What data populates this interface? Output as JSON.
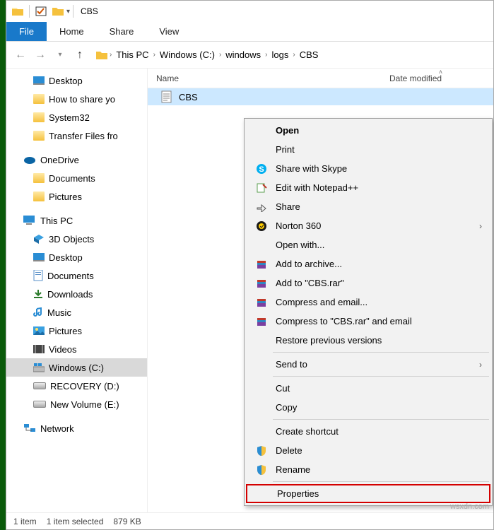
{
  "titlebar": {
    "title": "CBS"
  },
  "ribbon": {
    "file": "File",
    "home": "Home",
    "share": "Share",
    "view": "View"
  },
  "breadcrumb": [
    "This PC",
    "Windows (C:)",
    "windows",
    "logs",
    "CBS"
  ],
  "columns": {
    "name": "Name",
    "date": "Date modified"
  },
  "file": {
    "name": "CBS"
  },
  "tree": {
    "desktop": "Desktop",
    "howto": "How to share yo",
    "system32": "System32",
    "transfer": "Transfer Files fro",
    "onedrive": "OneDrive",
    "documents": "Documents",
    "pictures": "Pictures",
    "thispc": "This PC",
    "obj3d": "3D Objects",
    "desktop2": "Desktop",
    "documents2": "Documents",
    "downloads": "Downloads",
    "music": "Music",
    "pictures2": "Pictures",
    "videos": "Videos",
    "windowsc": "Windows (C:)",
    "recovery": "RECOVERY (D:)",
    "newvol": "New Volume (E:)",
    "network": "Network"
  },
  "ctx": {
    "open": "Open",
    "print": "Print",
    "skype": "Share with Skype",
    "notepad": "Edit with Notepad++",
    "share": "Share",
    "norton": "Norton 360",
    "openwith": "Open with...",
    "archive": "Add to archive...",
    "addrar": "Add to \"CBS.rar\"",
    "compress": "Compress and email...",
    "compressrar": "Compress to \"CBS.rar\" and email",
    "restore": "Restore previous versions",
    "sendto": "Send to",
    "cut": "Cut",
    "copy": "Copy",
    "shortcut": "Create shortcut",
    "delete": "Delete",
    "rename": "Rename",
    "properties": "Properties"
  },
  "status": {
    "items": "1 item",
    "selected": "1 item selected",
    "size": "879 KB"
  },
  "watermark": "wsxdn.com"
}
